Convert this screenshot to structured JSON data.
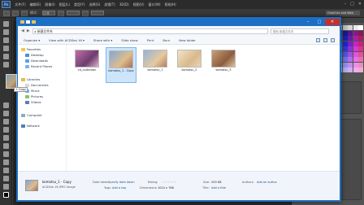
{
  "photoshop": {
    "logo": "Ps",
    "menu": [
      "文件(F)",
      "编辑(E)",
      "图像(I)",
      "图层(L)",
      "类型(Y)",
      "选择(S)",
      "滤镜(T)",
      "3D(D)",
      "视图(V)",
      "窗口(W)",
      "帮助(H)"
    ],
    "window_controls": [
      "–",
      "□",
      "✕"
    ],
    "options_label": "模式：",
    "options_mode": "正常",
    "workspace": "Graphics and Web"
  },
  "explorer": {
    "address": "▸ 新建文件夹",
    "search_placeholder": "搜索 新建文件夹",
    "nav_back": "◀",
    "nav_forward": "▶",
    "toolbar": [
      "Organize ▾",
      "View with ACDSee 16 ▾",
      "Share with ▾",
      "Slide show",
      "Print",
      "Burn",
      "New folder"
    ],
    "nav_items": {
      "favorites": "Favorites",
      "desktop": "Desktop",
      "downloads": "Downloads",
      "recent": "Recent Places",
      "libraries": "Libraries",
      "documents": "Documents",
      "music": "Music",
      "pictures": "Pictures",
      "videos": "Videos",
      "computer": "Computer",
      "network": "Network"
    },
    "files": [
      {
        "name": "cd_collection",
        "selected": false
      },
      {
        "name": "komatsu_1 - Copy",
        "selected": true
      },
      {
        "name": "komatsu_1",
        "selected": false
      },
      {
        "name": "komatsu_2",
        "selected": false
      },
      {
        "name": "komatsu_3",
        "selected": false
      }
    ],
    "details": {
      "name": "komatsu_1 - Copy",
      "type": "ACDSee 16 JPEG Image",
      "date_taken_label": "Date taken:",
      "date_taken": "Specify date taken",
      "tags_label": "Tags:",
      "tags": "Add a tag",
      "rating_label": "Rating:",
      "rating_stars": "☆☆☆☆☆",
      "dimensions_label": "Dimensions:",
      "dimensions": "1024 x 768",
      "size_label": "Size:",
      "size": "200 KB",
      "title_label": "Title:",
      "title": "Add a title",
      "authors_label": "Authors:",
      "authors": "Add an author"
    },
    "window_buttons": [
      "–",
      "□",
      "✕"
    ]
  },
  "drag": {
    "badge": "+ Copy"
  },
  "colors": {
    "accent": "#1c6fc4",
    "selection": "#cce5fb",
    "close": "#c7302a"
  }
}
